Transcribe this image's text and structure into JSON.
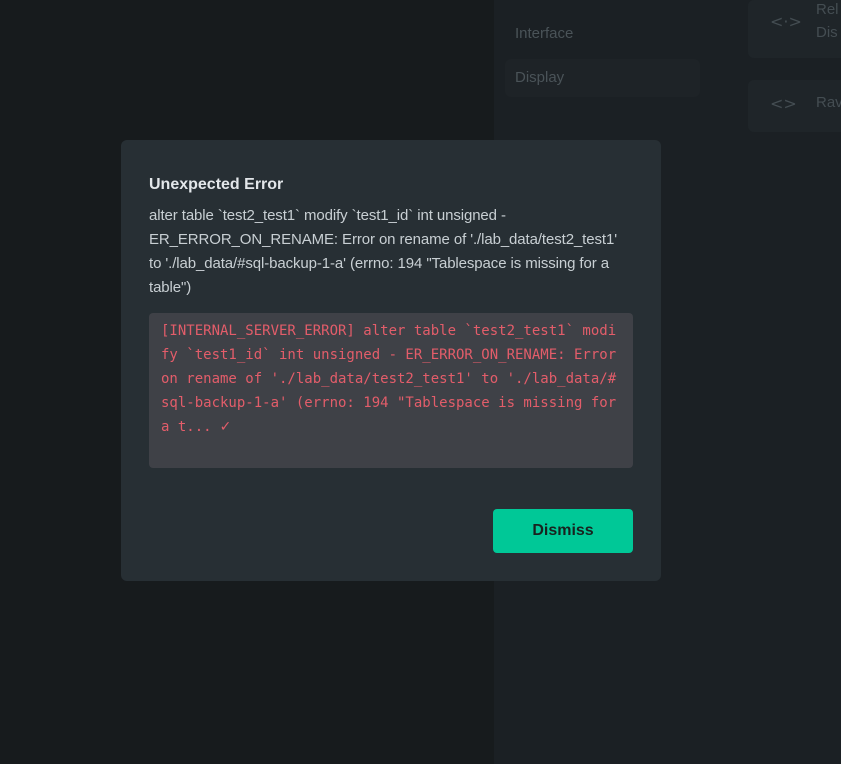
{
  "background": {
    "menu": [
      "Interface",
      "Display"
    ],
    "cards": [
      {
        "icon": "code-icon",
        "title": "Rel",
        "subtitle": "Dis"
      },
      {
        "icon": "code-icon",
        "title": "Rav",
        "subtitle": ""
      }
    ]
  },
  "dialog": {
    "title": "Unexpected Error",
    "message": "alter table `test2_test1` modify `test1_id` int unsigned - ER_ERROR_ON_RENAME: Error on rename of './lab_data/test2_test1' to './lab_data/#sql-backup-1-a' (errno: 194 \"Tablespace is missing for a table\")",
    "error_detail": "[INTERNAL_SERVER_ERROR] alter table `test2_test1` modify `test1_id` int unsigned - ER_ERROR_ON_RENAME: Error on rename of './lab_data/test2_test1' to './lab_data/#sql-backup-1-a' (errno: 194 \"Tablespace is missing for a t...",
    "copy_icon": "check-icon",
    "dismiss_label": "Dismiss"
  },
  "colors": {
    "accent": "#00c897",
    "error_text": "#e35d6a",
    "dialog_bg": "#272f34"
  }
}
